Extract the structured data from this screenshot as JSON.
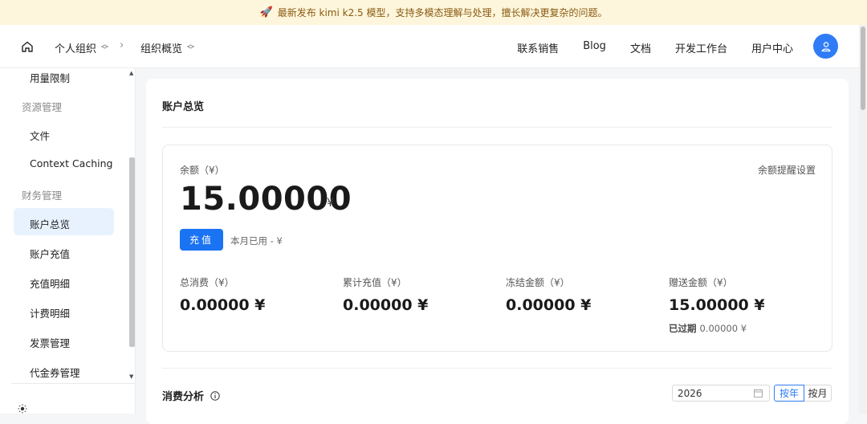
{
  "banner": {
    "icon": "rocket-icon",
    "text": "最新发布 kimi k2.5 模型，支持多模态理解与处理，擅长解决更复杂的问题。"
  },
  "header": {
    "breadcrumb": {
      "org": "个人组织",
      "page": "组织概览"
    },
    "nav": [
      "联系销售",
      "Blog",
      "文档",
      "开发工作台",
      "用户中心"
    ]
  },
  "sidebar": {
    "items": [
      {
        "label": "用量限制",
        "type": "item"
      },
      {
        "label": "资源管理",
        "type": "group"
      },
      {
        "label": "文件",
        "type": "item"
      },
      {
        "label": "Context Caching",
        "type": "item"
      },
      {
        "label": "财务管理",
        "type": "group"
      },
      {
        "label": "账户总览",
        "type": "item",
        "active": true
      },
      {
        "label": "账户充值",
        "type": "item"
      },
      {
        "label": "充值明细",
        "type": "item"
      },
      {
        "label": "计费明细",
        "type": "item"
      },
      {
        "label": "发票管理",
        "type": "item"
      },
      {
        "label": "代金券管理",
        "type": "item"
      }
    ]
  },
  "account": {
    "title": "账户总览",
    "balance_label": "余额（¥）",
    "balance_setting": "余额提醒设置",
    "balance": "15.00000",
    "currency": "¥",
    "recharge_button": "充值",
    "used_this_month": "本月已用 - ¥",
    "stats": [
      {
        "label": "总消费（¥）",
        "value": "0.00000 ¥"
      },
      {
        "label": "累计充值（¥）",
        "value": "0.00000 ¥"
      },
      {
        "label": "冻结金额（¥）",
        "value": "0.00000 ¥"
      },
      {
        "label": "赠送金额（¥）",
        "value": "15.00000 ¥"
      }
    ],
    "expired_label": "已过期",
    "expired_value": "0.00000 ¥"
  },
  "analysis": {
    "title": "消费分析",
    "year": "2026",
    "by_year": "按年",
    "by_month": "按月"
  },
  "colors": {
    "accent": "#1a73f2",
    "active_bg": "#e8f2ff",
    "banner_bg": "#fdf6dc"
  }
}
